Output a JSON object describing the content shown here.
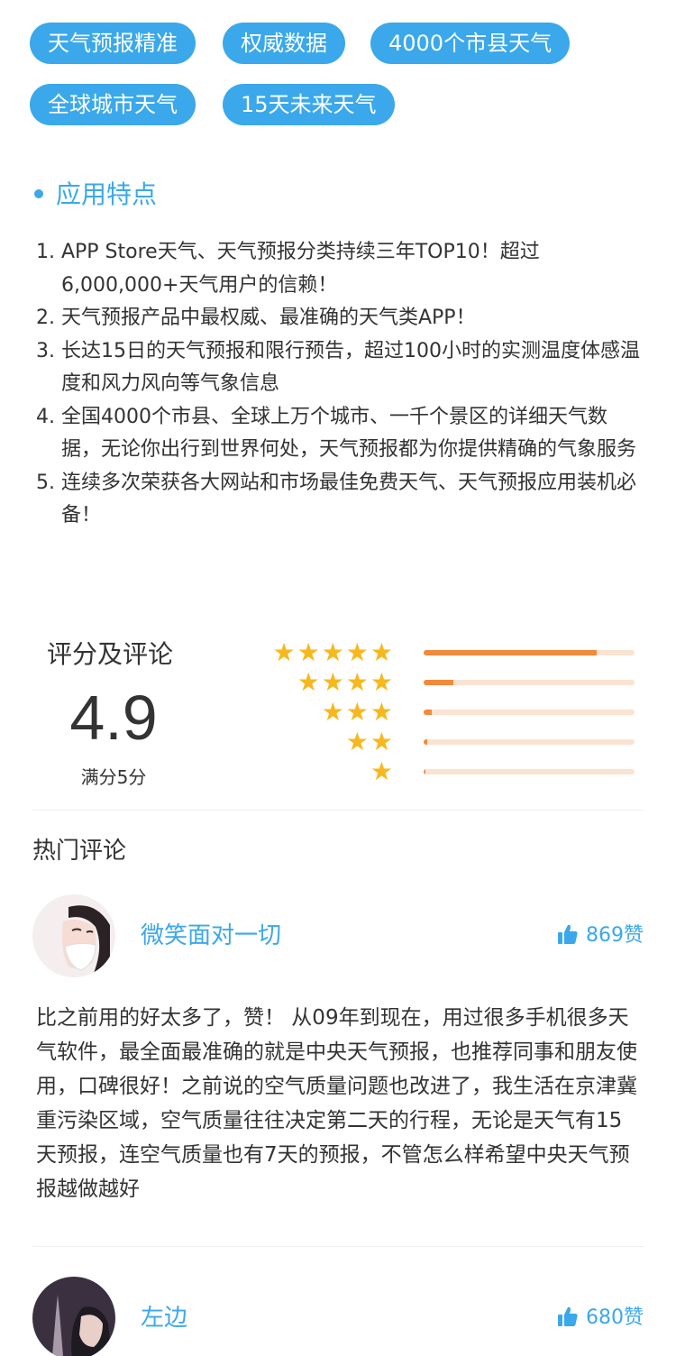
{
  "tags": [
    "天气预报精准",
    "权威数据",
    "4000个市县天气",
    "全球城市天气",
    "15天未来天气"
  ],
  "features_title": "应用特点",
  "features": [
    {
      "num": "1. ",
      "text": "APP Store天气、天气预报分类持续三年TOP10！超过6,000,000+天气用户的信赖！"
    },
    {
      "num": "2. ",
      "text": "天气预报产品中最权威、最准确的天气类APP！"
    },
    {
      "num": "3. ",
      "text": "长达15日的天气预报和限行预告，超过100小时的实测温度体感温度和风力风向等气象信息"
    },
    {
      "num": "4. ",
      "text": "全国4000个市县、全球上万个城市、一千个景区的详细天气数据，无论你出行到世界何处，天气预报都为你提供精确的气象服务"
    },
    {
      "num": "5. ",
      "text": "连续多次荣获各大网站和市场最佳免费天气、天气预报应用装机必备！"
    }
  ],
  "rating": {
    "title": "评分及评论",
    "score": "4.9",
    "full": "满分5分",
    "distribution": [
      {
        "stars": 5,
        "fraction": 0.82
      },
      {
        "stars": 4,
        "fraction": 0.14
      },
      {
        "stars": 3,
        "fraction": 0.04
      },
      {
        "stars": 2,
        "fraction": 0.015
      },
      {
        "stars": 1,
        "fraction": 0.01
      }
    ],
    "star_color": "#f7b81d",
    "bar_color": "#f28a3a",
    "bar_track_color": "#fbe3d2"
  },
  "comments_title": "热门评论",
  "comments": [
    {
      "user": "微笑面对一切",
      "likes": "869赞",
      "avatar_icon": "user-avatar-girl-mask",
      "text": "比之前用的好太多了，赞！ 从09年到现在，用过很多手机很多天气软件，最全面最准确的就是中央天气预报，也推荐同事和朋友使用，口碑很好！之前说的空气质量问题也改进了，我生活在京津冀重污染区域，空气质量往往决定第二天的行程，无论是天气有15天预报，连空气质量也有7天的预报，不管怎么样希望中央天气预报越做越好"
    },
    {
      "user": "左边",
      "likes": "680赞",
      "avatar_icon": "user-avatar-girl-eiffel"
    }
  ],
  "accent_color": "#3aa8ea"
}
